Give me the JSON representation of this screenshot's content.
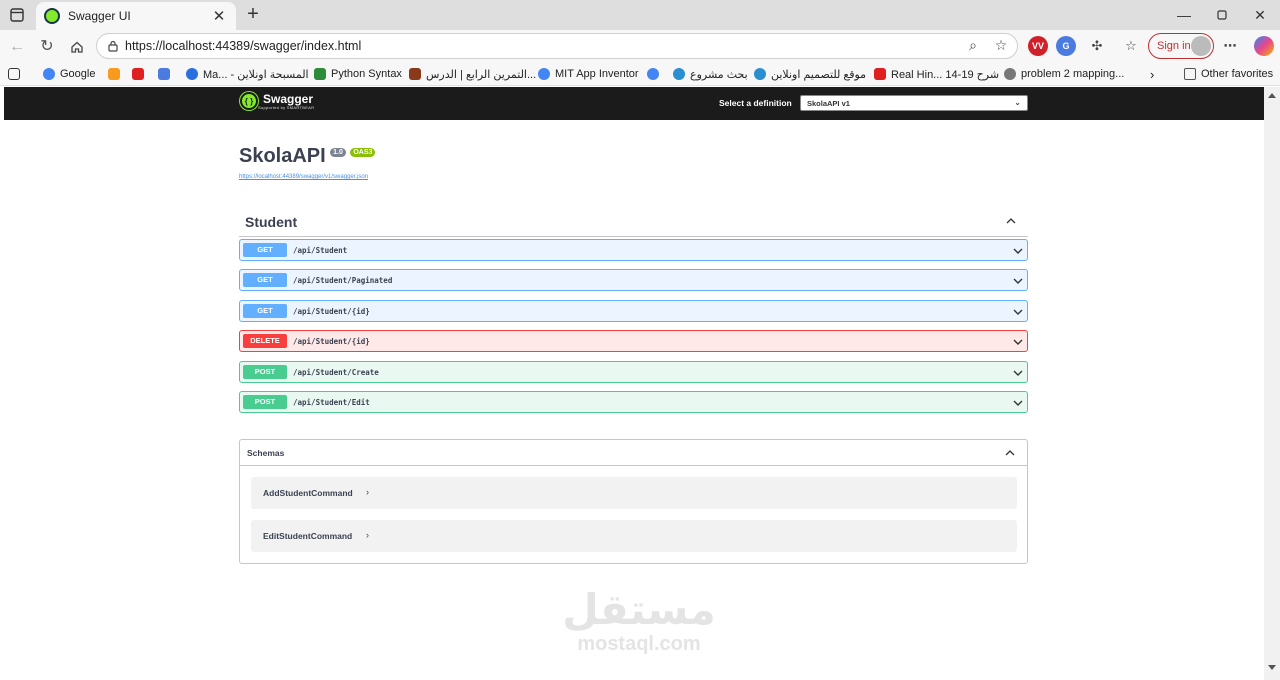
{
  "browser": {
    "tab_title": "Swagger UI",
    "tab_close": "✕",
    "new_tab": "+",
    "url": "https://localhost:44389/swagger/index.html",
    "signin_label": "Sign in",
    "bookmarks": [
      "Google",
      "Ma... - المسبحة اونلاين",
      "Python Syntax",
      "التمرين الرابع | الدرس...",
      "MIT App Inventor",
      "بحث مشروع",
      "موقع للتصميم اونلاين",
      "Real Hin... شرح 19-14",
      "problem 2 mapping...",
      "Other favorites"
    ]
  },
  "swagger": {
    "logo_text": "Swagger",
    "logo_sub": "Supported by SMARTBEAR",
    "definition_label": "Select a definition",
    "definition_value": "SkolaAPI v1",
    "api_title": "SkolaAPI",
    "version_badge": "1.0",
    "oas_badge": "OAS3",
    "spec_url": "https://localhost:44389/swagger/v1/swagger.json",
    "tag_name": "Student",
    "operations": [
      {
        "method": "GET",
        "path": "/api/Student"
      },
      {
        "method": "GET",
        "path": "/api/Student/Paginated"
      },
      {
        "method": "GET",
        "path": "/api/Student/{id}"
      },
      {
        "method": "DELETE",
        "path": "/api/Student/{id}"
      },
      {
        "method": "POST",
        "path": "/api/Student/Create"
      },
      {
        "method": "POST",
        "path": "/api/Student/Edit"
      }
    ],
    "schemas_title": "Schemas",
    "models": [
      "AddStudentCommand",
      "EditStudentCommand"
    ],
    "model_arrow": "›"
  },
  "watermark": {
    "arabic": "مستقل",
    "latin": "mostaql.com"
  },
  "colors": {
    "get": "#61affe",
    "delete": "#f93e3e",
    "post": "#49cc90",
    "topbar": "#1b1b1b",
    "swagger_green": "#85ea2d"
  }
}
